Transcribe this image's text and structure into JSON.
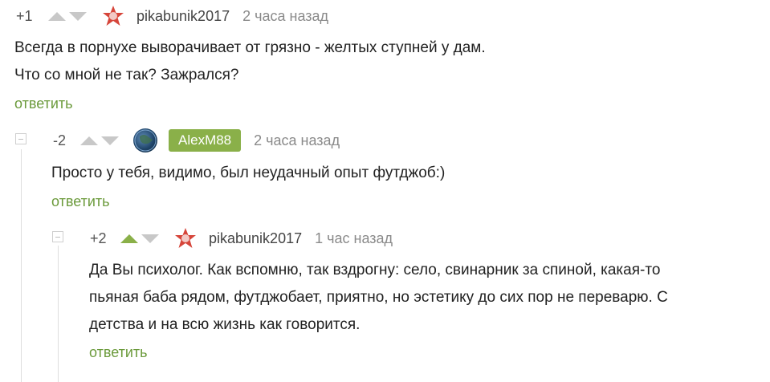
{
  "comments": [
    {
      "score": "+1",
      "username": "pikabunik2017",
      "time": "2 часа назад",
      "lines": [
        "Всегда в порнухе выворачивает от грязно - желтых ступней у дам.",
        "Что со мной не так? Зажрался?"
      ],
      "reply_label": "ответить",
      "avatar_icon": "star-medal-icon"
    },
    {
      "score": "-2",
      "username": "AlexM88",
      "time": "2 часа назад",
      "lines": [
        "Просто у тебя, видимо, был неудачный опыт футджоб:)"
      ],
      "reply_label": "ответить",
      "avatar_icon": "globe-avatar-icon"
    },
    {
      "score": "+2",
      "username": "pikabunik2017",
      "time": "1 час назад",
      "lines": [
        "Да Вы психолог. Как вспомню, так вздрогну: село, свинарник за спиной, какая-то",
        "пьяная баба рядом, футджобает, приятно, но эстетику до сих пор не переварю. С",
        "детства и на всю жизнь как говорится."
      ],
      "reply_label": "ответить",
      "avatar_icon": "star-medal-icon"
    }
  ],
  "colors": {
    "accent_green": "#8ab049",
    "link_green": "#6b9a3b",
    "arrow_grey": "#c8c8c8"
  }
}
